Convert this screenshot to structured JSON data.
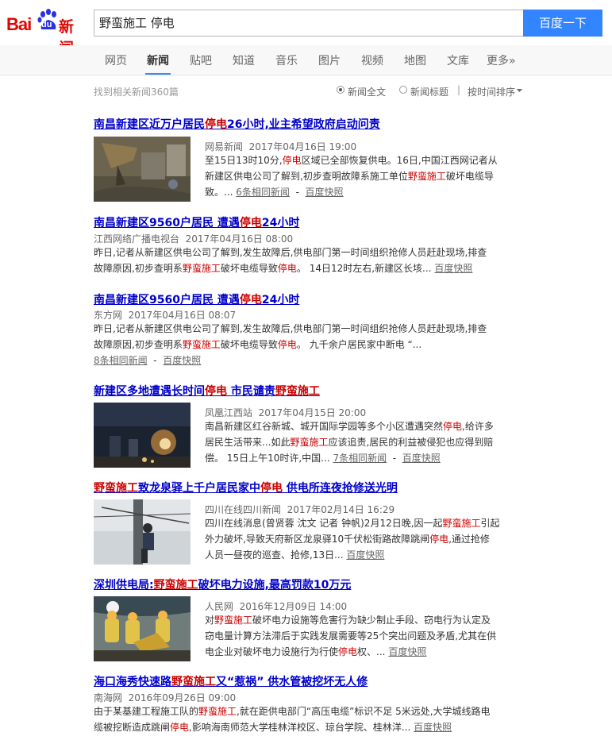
{
  "logo": {
    "bai": "Bai",
    "du": "du",
    "news": "新闻"
  },
  "search": {
    "query": "野蛮施工 停电",
    "button": "百度一下"
  },
  "nav": [
    "网页",
    "新闻",
    "贴吧",
    "知道",
    "音乐",
    "图片",
    "视频",
    "地图",
    "文库",
    "更多»"
  ],
  "subbar": {
    "count": "找到相关新闻360篇",
    "opt_full": "新闻全文",
    "opt_title": "新闻标题",
    "sep": "|",
    "sort": "按时间排序"
  },
  "results": [
    {
      "title_pre": "南昌新建区近万户居民",
      "title_hl": "停电",
      "title_post": "26小时,业主希望政府启动问责",
      "source": "网易新闻",
      "time": "2017年04月16日 19:00",
      "l1_pre": "至15日13时10分,",
      "l1_hl": "停电",
      "l1_post": "区域已全部恢复供电。16日,中国江西网记者从",
      "l2_pre": "新建区供电公司了解到,初步查明故障系施工单位",
      "l2_hl": "野蛮施工",
      "l2_post": "破坏电缆导",
      "l3": "致。...",
      "same": "6条相同新闻",
      "dash": "-",
      "cache": "百度快照"
    },
    {
      "title_pre": "南昌新建区9560户居民 遭遇",
      "title_hl": "停电",
      "title_post": "24小时",
      "source": "江西网络广播电视台",
      "time": "2017年04月16日 08:00",
      "l1": "昨日,记者从新建区供电公司了解到,发生故障后,供电部门第一时间组织抢修人员赶赴现场,排查",
      "l2_pre": "故障原因,初步查明系",
      "l2_hl": "野蛮施工",
      "l2_mid": "破坏电缆导致",
      "l2_hl2": "停电",
      "l2_post": "。 14日12时左右,新建区长垓...",
      "dash": "-",
      "cache": "百度快照"
    },
    {
      "title_pre": "南昌新建区9560户居民 遭遇",
      "title_hl": "停电",
      "title_post": "24小时",
      "source": "东方网",
      "time": "2017年04月16日 08:07",
      "l1": "昨日,记者从新建区供电公司了解到,发生故障后,供电部门第一时间组织抢修人员赶赴现场,排查",
      "l2_pre": "故障原因,初步查明系",
      "l2_hl": "野蛮施工",
      "l2_mid": "破坏电缆导致",
      "l2_hl2": "停电",
      "l2_post": "。 九千余户居民家中断电 “...",
      "same": "8条相同新闻",
      "dash": "-",
      "cache": "百度快照"
    },
    {
      "title_pre": "新建区多地遭遇长时间",
      "title_hl": "停电",
      "title_mid": " 市民谴责",
      "title_hl2": "野蛮施工",
      "source": "凤凰江西站",
      "time": "2017年04月15日 20:00",
      "l1_pre": "南昌新建区红谷新城、城开国际学园等多个小区遭遇突然",
      "l1_hl": "停电",
      "l1_post": ",给许多",
      "l2_pre": "居民生活带来...如此",
      "l2_hl": "野蛮施工",
      "l2_post": "应该追责,居民的利益被侵犯也应得到赔",
      "l3": "偿。 15日上午10时许,中国...",
      "same": "7条相同新闻",
      "dash": "-",
      "cache": "百度快照"
    },
    {
      "title_hl": "野蛮施工",
      "title_mid": "致龙泉驿上千户居民家中",
      "title_hl2": "停电",
      "title_post": " 供电所连夜抢修送光明",
      "source": "四川在线四川新闻",
      "time": "2017年02月14日 16:29",
      "l1_pre": "四川在线消息(曾贤蓉 沈文 记者 钟帆)2月12日晚,因一起",
      "l1_hl": "野蛮施工",
      "l1_post": "引起",
      "l2_pre": "外力破坏,导致天府新区龙泉驿10千伏松街路故障跳闸",
      "l2_hl": "停电",
      "l2_post": ",通过抢修",
      "l3": "人员一昼夜的巡查、抢修,13日...",
      "cache": "百度快照"
    },
    {
      "title_pre": "深圳供电局:",
      "title_hl": "野蛮施工",
      "title_post": "破坏电力设施,最高罚款10万元",
      "source": "人民网",
      "time": "2016年12月09日 14:00",
      "l1_pre": "对",
      "l1_hl": "野蛮施工",
      "l1_post": "破坏电力设施等危害行为缺少制止手段、窃电行为认定及",
      "l2": "窃电量计算方法滞后于实践发展需要等25个突出问题及矛盾,尤其在供",
      "l3_pre": "电企业对破坏电力设施行为行使",
      "l3_hl": "停电",
      "l3_post": "权、...",
      "cache": "百度快照"
    },
    {
      "title_pre": "海口海秀快速路",
      "title_hl": "野蛮施工",
      "title_post": "又“惹祸” 供水管被挖坏无人修",
      "source": "南海网",
      "time": "2016年09月26日 09:00",
      "l1_pre": "由于某基建工程施工队的",
      "l1_hl": "野蛮施工",
      "l1_post": ",就在距供电部门“高压电缆”标识不足 5米远处,大学城线路电",
      "l2_pre": "缆被挖断造成跳闸",
      "l2_hl": "停电",
      "l2_post": ",影响海南师范大学桂林洋校区、琼台学院、桂林洋...",
      "cache": "百度快照"
    }
  ]
}
